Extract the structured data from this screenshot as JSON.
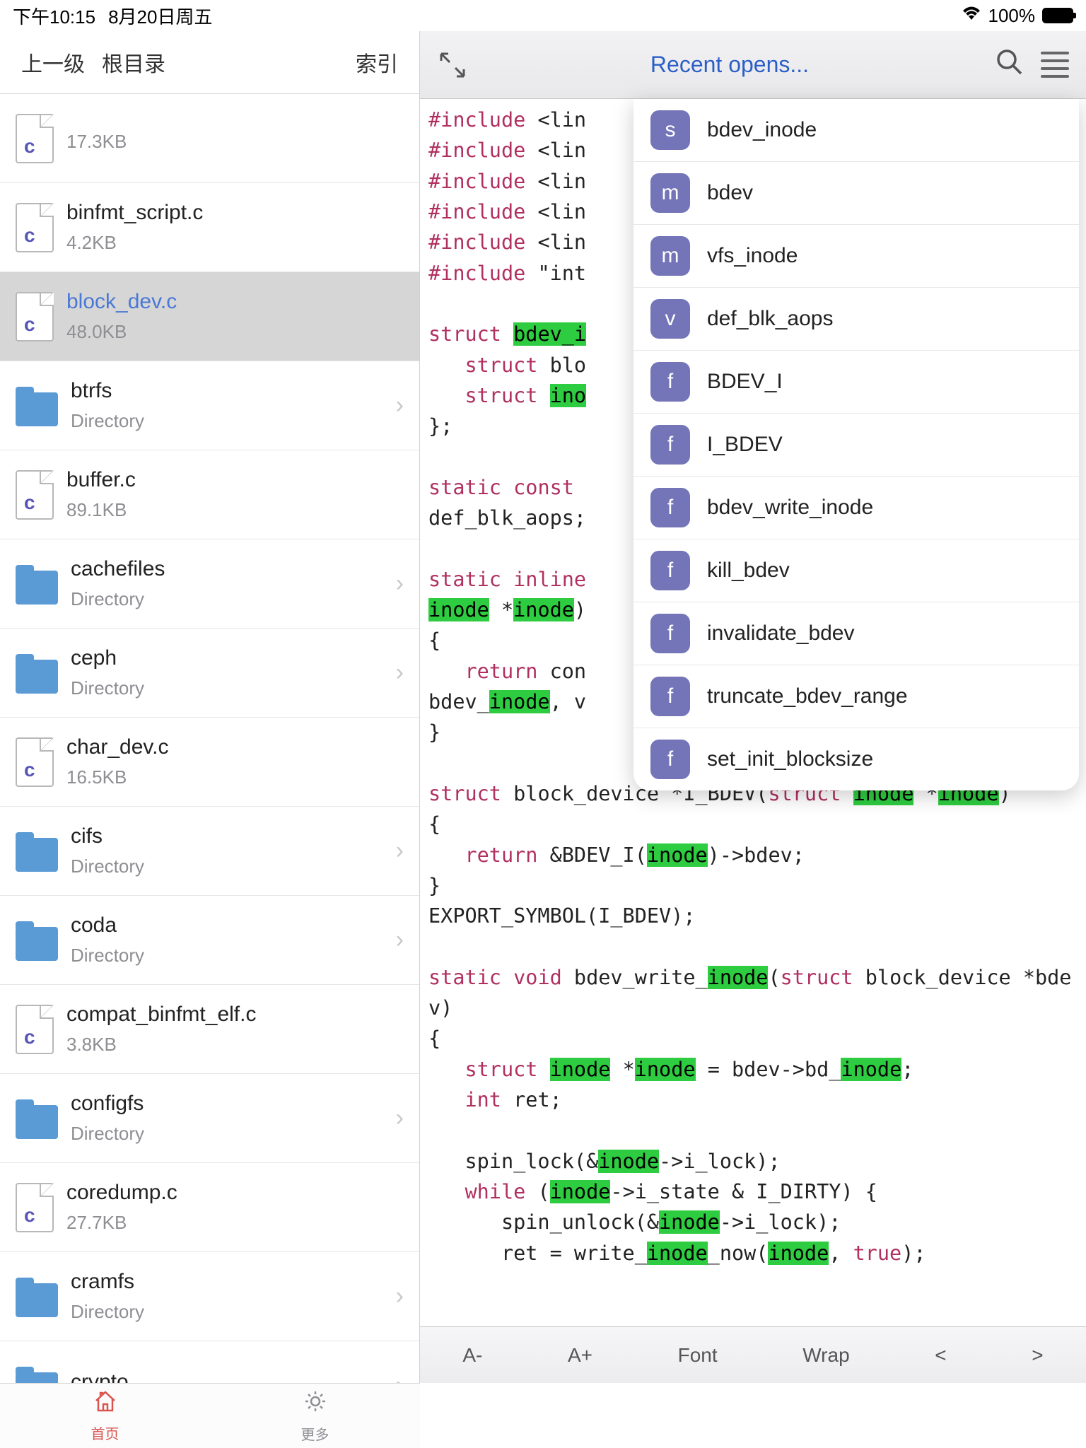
{
  "status": {
    "time": "下午10:15",
    "date": "8月20日周五",
    "battery": "100%"
  },
  "sidebar": {
    "back": "上一级",
    "root": "根目录",
    "index": "索引",
    "items": [
      {
        "name": "",
        "meta": "17.3KB",
        "type": "c"
      },
      {
        "name": "binfmt_script.c",
        "meta": "4.2KB",
        "type": "c"
      },
      {
        "name": "block_dev.c",
        "meta": "48.0KB",
        "type": "c",
        "selected": true
      },
      {
        "name": "btrfs",
        "meta": "Directory",
        "type": "dir"
      },
      {
        "name": "buffer.c",
        "meta": "89.1KB",
        "type": "c"
      },
      {
        "name": "cachefiles",
        "meta": "Directory",
        "type": "dir"
      },
      {
        "name": "ceph",
        "meta": "Directory",
        "type": "dir"
      },
      {
        "name": "char_dev.c",
        "meta": "16.5KB",
        "type": "c"
      },
      {
        "name": "cifs",
        "meta": "Directory",
        "type": "dir"
      },
      {
        "name": "coda",
        "meta": "Directory",
        "type": "dir"
      },
      {
        "name": "compat_binfmt_elf.c",
        "meta": "3.8KB",
        "type": "c"
      },
      {
        "name": "configfs",
        "meta": "Directory",
        "type": "dir"
      },
      {
        "name": "coredump.c",
        "meta": "27.7KB",
        "type": "c"
      },
      {
        "name": "cramfs",
        "meta": "Directory",
        "type": "dir"
      },
      {
        "name": "crypto",
        "meta": "",
        "type": "dir"
      }
    ]
  },
  "header": {
    "title": "Recent opens..."
  },
  "dropdown": [
    {
      "k": "s",
      "label": "bdev_inode"
    },
    {
      "k": "m",
      "label": "bdev"
    },
    {
      "k": "m",
      "label": "vfs_inode"
    },
    {
      "k": "v",
      "label": "def_blk_aops"
    },
    {
      "k": "f",
      "label": "BDEV_I"
    },
    {
      "k": "f",
      "label": "I_BDEV"
    },
    {
      "k": "f",
      "label": "bdev_write_inode"
    },
    {
      "k": "f",
      "label": "kill_bdev"
    },
    {
      "k": "f",
      "label": "invalidate_bdev"
    },
    {
      "k": "f",
      "label": "truncate_bdev_range"
    },
    {
      "k": "f",
      "label": "set_init_blocksize"
    }
  ],
  "toolbar": {
    "dec": "A-",
    "inc": "A+",
    "font": "Font",
    "wrap": "Wrap",
    "lt": "<",
    "gt": ">"
  },
  "tabs": {
    "home": "首页",
    "more": "更多"
  },
  "code": {
    "inc1": "#include",
    "lin": "<lin",
    "incq": "\"int",
    "l_struct": "struct",
    "l_static": "static",
    "l_const": "const",
    "l_inline": "inline",
    "l_return": "return",
    "l_int": "int",
    "l_while": "while",
    "l_true": "true",
    "bdev_i": "bdev_i",
    "blo": "blo",
    "ino": "ino",
    "def_blk": "def_blk_aops;",
    "inode": "inode",
    "con": "con",
    "bdev_u": "bdev_",
    "v": ", v",
    "block_device": "block_device *I_BDEV(",
    "ret_amp": " &BDEV_I(",
    "arrow_bdev": ")->bdev;",
    "export": "EXPORT_SYMBOL(I_BDEV);",
    "void": "void",
    "bdev_write": " bdev_write_",
    "bd_sig": "block_device *bdev)",
    "eq_bdev": " = bdev->bd_",
    "int_ret": " ret;",
    "spin_lock": "spin_lock(&",
    "i_lock": "->i_lock);",
    "i_state": "->i_state & I_DIRTY) {",
    "spin_unlock": "spin_unlock(&",
    "ret_eq": "ret = write_",
    "now": "_now("
  }
}
